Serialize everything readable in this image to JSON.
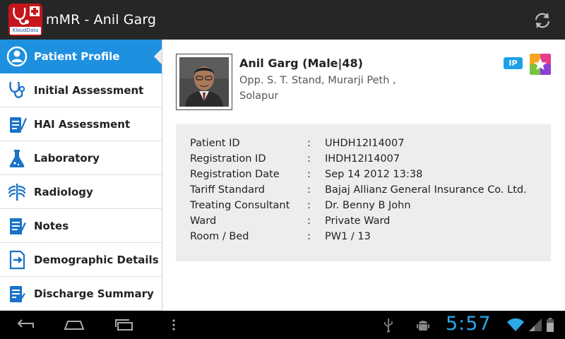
{
  "app": {
    "title": "mMR - Anil Garg",
    "logo_text": "KloudData"
  },
  "sidebar": {
    "items": [
      {
        "label": "Patient Profile",
        "icon": "user-circle-icon",
        "active": true
      },
      {
        "label": "Initial Assessment",
        "icon": "stethoscope-icon"
      },
      {
        "label": "HAI Assessment",
        "icon": "clipboard-pen-icon"
      },
      {
        "label": "Laboratory",
        "icon": "flask-icon"
      },
      {
        "label": "Radiology",
        "icon": "ribcage-icon"
      },
      {
        "label": "Notes",
        "icon": "notes-pen-icon"
      },
      {
        "label": "Demographic Details",
        "icon": "document-arrow-icon"
      },
      {
        "label": "Discharge Summary",
        "icon": "discharge-doc-icon"
      }
    ]
  },
  "patient": {
    "name": "Anil Garg (Male|48)",
    "address_line1": "Opp. S. T. Stand, Murarji Peth  ,",
    "address_line2": "Solapur",
    "badge": "IP"
  },
  "details": {
    "separator": ":",
    "rows": [
      {
        "label": "Patient ID",
        "value": "UHDH12I14007"
      },
      {
        "label": "Registration ID",
        "value": "IHDH12I14007"
      },
      {
        "label": "Registration Date",
        "value": "Sep 14 2012 13:38"
      },
      {
        "label": "Tariff Standard",
        "value": "Bajaj Allianz General Insurance Co. Ltd."
      },
      {
        "label": "Treating Consultant",
        "value": "Dr. Benny  B John"
      },
      {
        "label": "Ward",
        "value": "Private Ward"
      },
      {
        "label": "Room / Bed",
        "value": "PW1 / 13"
      }
    ]
  },
  "system_bar": {
    "time": "5:57"
  },
  "colors": {
    "accent": "#1e90e0",
    "action_bar": "#262626",
    "clock": "#2aa8e8",
    "logo_red": "#c4161c"
  }
}
